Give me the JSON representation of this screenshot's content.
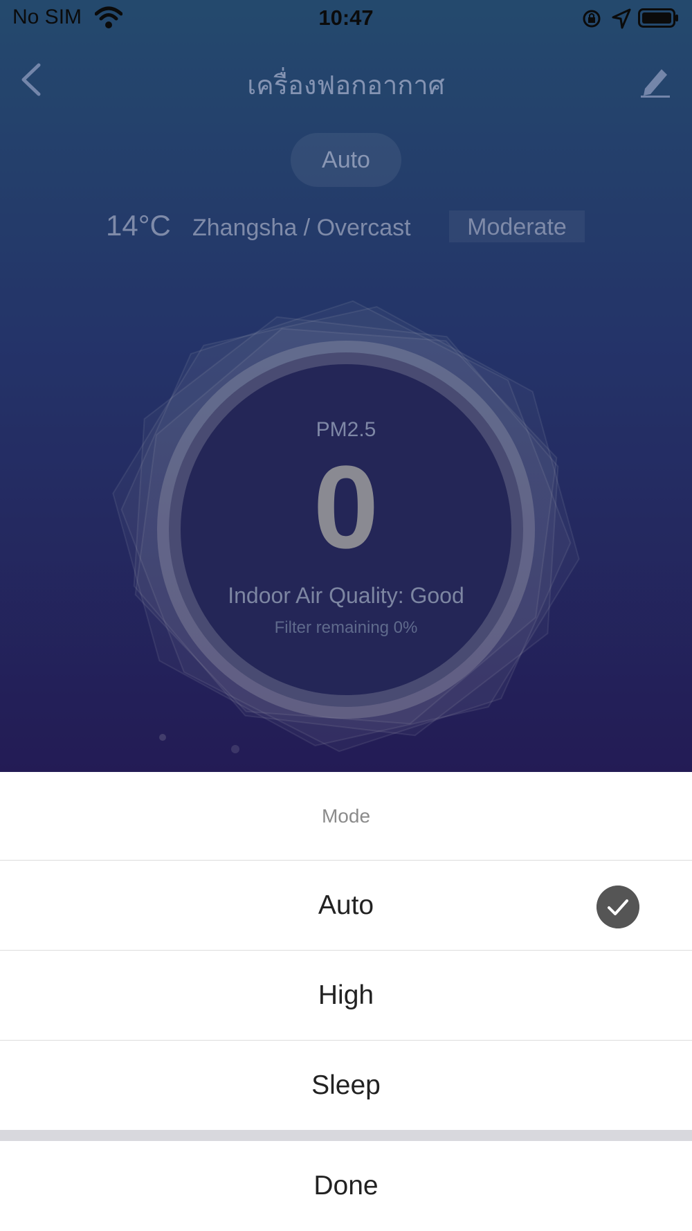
{
  "status_bar": {
    "carrier": "No SIM",
    "time": "10:47",
    "icons": [
      "wifi-icon",
      "rotation-lock-icon",
      "location-arrow-icon",
      "battery-icon"
    ]
  },
  "nav": {
    "title": "เครื่องฟอกอากาศ",
    "back_icon": "chevron-left-icon",
    "edit_icon": "pencil-icon"
  },
  "device": {
    "current_mode": "Auto",
    "temperature": "14°C",
    "location_weather": "Zhangsha / Overcast",
    "outdoor_quality": "Moderate",
    "pm_label": "PM2.5",
    "pm_value": "0",
    "indoor_quality": "Indoor Air Quality: Good",
    "filter_remaining": "Filter remaining 0%"
  },
  "mode_sheet": {
    "title": "Mode",
    "options": [
      {
        "label": "Auto",
        "selected": true
      },
      {
        "label": "High",
        "selected": false
      },
      {
        "label": "Sleep",
        "selected": false
      }
    ],
    "done_label": "Done"
  },
  "colors": {
    "gradient_top": "#2c5a86",
    "gradient_bottom": "#2b2268",
    "check_bg": "#555555"
  }
}
